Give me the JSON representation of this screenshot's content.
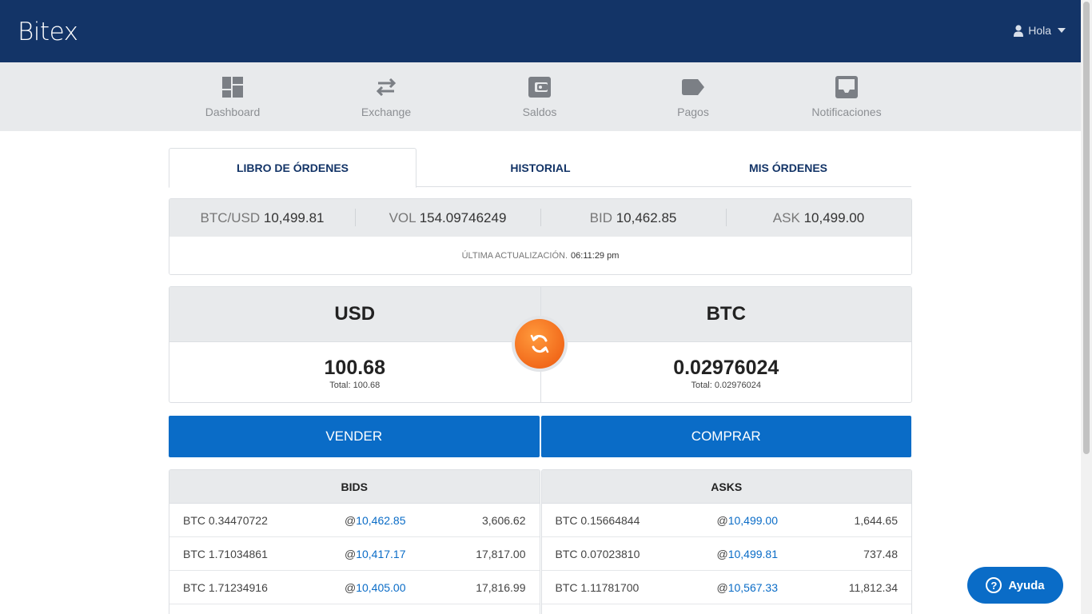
{
  "header": {
    "brand": "Bitex",
    "user_label": "Hola"
  },
  "nav": [
    {
      "label": "Dashboard",
      "icon": "dashboard-icon"
    },
    {
      "label": "Exchange",
      "icon": "exchange-icon"
    },
    {
      "label": "Saldos",
      "icon": "wallet-icon"
    },
    {
      "label": "Pagos",
      "icon": "tag-icon"
    },
    {
      "label": "Notificaciones",
      "icon": "inbox-icon"
    }
  ],
  "tabs": [
    {
      "label": "LIBRO DE ÓRDENES",
      "active": true
    },
    {
      "label": "HISTORIAL",
      "active": false
    },
    {
      "label": "MIS ÓRDENES",
      "active": false
    }
  ],
  "ticker": {
    "pair_label": "BTC/USD",
    "pair_value": "10,499.81",
    "vol_label": "VOL",
    "vol_value": "154.09746249",
    "bid_label": "BID",
    "bid_value": "10,462.85",
    "ask_label": "ASK",
    "ask_value": "10,499.00",
    "update_label": "ÚLTIMA ACTUALIZACIÓN.",
    "update_time": "06:11:29 pm"
  },
  "balances": {
    "left": {
      "currency": "USD",
      "amount": "100.68",
      "total": "Total: 100.68"
    },
    "right": {
      "currency": "BTC",
      "amount": "0.02976024",
      "total": "Total: 0.02976024"
    }
  },
  "actions": {
    "sell": "VENDER",
    "buy": "COMPRAR"
  },
  "book": {
    "bids_title": "BIDS",
    "asks_title": "ASKS",
    "bids": [
      {
        "amount": "BTC 0.34470722",
        "at": "@",
        "price": "10,462.85",
        "total": "3,606.62"
      },
      {
        "amount": "BTC 1.71034861",
        "at": "@",
        "price": "10,417.17",
        "total": "17,817.00"
      },
      {
        "amount": "BTC 1.71234916",
        "at": "@",
        "price": "10,405.00",
        "total": "17,816.99"
      }
    ],
    "asks": [
      {
        "amount": "BTC 0.15664844",
        "at": "@",
        "price": "10,499.00",
        "total": "1,644.65"
      },
      {
        "amount": "BTC 0.07023810",
        "at": "@",
        "price": "10,499.81",
        "total": "737.48"
      },
      {
        "amount": "BTC 1.11781700",
        "at": "@",
        "price": "10,567.33",
        "total": "11,812.34"
      }
    ]
  },
  "help": {
    "label": "Ayuda",
    "icon_glyph": "?"
  },
  "colors": {
    "header_bg": "#133467",
    "nav_bg": "#e8eaec",
    "primary": "#0a6cc7",
    "swap_orange": "#f26a1b"
  }
}
